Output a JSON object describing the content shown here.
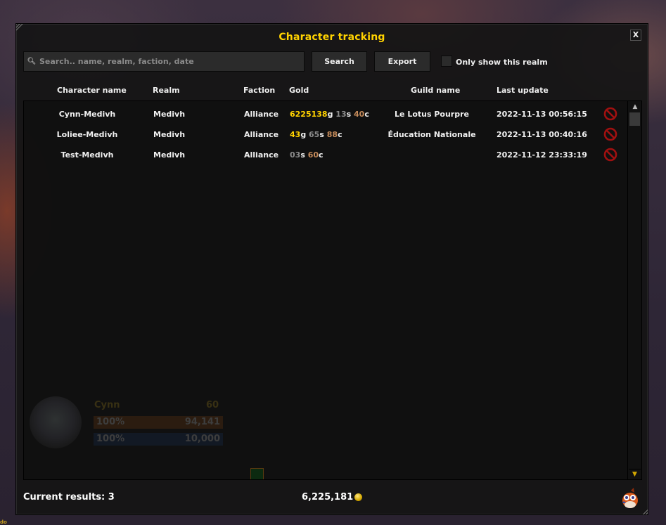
{
  "window": {
    "title": "Character tracking",
    "close_label": "X"
  },
  "toolbar": {
    "search_placeholder": "Search.. name, realm, faction, date",
    "search_value": "",
    "search_icon": "magnifier-icon",
    "search_label": "Search",
    "export_label": "Export",
    "realm_filter_label": "Only show this realm",
    "realm_filter_checked": false
  },
  "columns": [
    "Character name",
    "Realm",
    "Faction",
    "Gold",
    "Guild name",
    "Last update"
  ],
  "rows": [
    {
      "name": "Cynn-Medivh",
      "realm": "Medivh",
      "faction": "Alliance",
      "gold": {
        "g": "6225138",
        "s": "13",
        "c": "40"
      },
      "guild": "Le Lotus Pourpre",
      "last_update": "2022-11-13 00:56:15"
    },
    {
      "name": "Loliee-Medivh",
      "realm": "Medivh",
      "faction": "Alliance",
      "gold": {
        "g": "43",
        "s": "65",
        "c": "88"
      },
      "guild": "Éducation Nationale",
      "last_update": "2022-11-13 00:40:16"
    },
    {
      "name": "Test-Medivh",
      "realm": "Medivh",
      "faction": "Alliance",
      "gold": {
        "g": null,
        "s": "03",
        "c": "60"
      },
      "guild": "",
      "last_update": "2022-11-12 23:33:19"
    }
  ],
  "currency_units": {
    "g": "g",
    "s": "s",
    "c": "c"
  },
  "footer": {
    "results_label": "Current results: 3",
    "total_gold": "6,225,181"
  },
  "background_unit_frame": {
    "name": "Cynn",
    "level": "60",
    "health_pct": "100%",
    "health_value": "94,141",
    "mana_pct": "100%",
    "mana_value": "10,000"
  },
  "colors": {
    "title": "#ffd200",
    "gold": "#ffd200",
    "silver": "#8c8c8c",
    "copper": "#c48a5a",
    "delete": "#a01010"
  }
}
